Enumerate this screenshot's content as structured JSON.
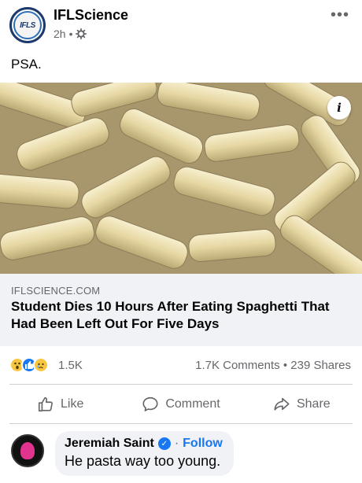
{
  "post": {
    "page_name": "IFLScience",
    "avatar_text": "IFLS",
    "time": "2h",
    "separator": "•",
    "more": "•••",
    "text": "PSA."
  },
  "image": {
    "info_label": "i"
  },
  "link": {
    "domain": "IFLSCIENCE.COM",
    "headline": "Student Dies 10 Hours After Eating Spaghetti That Had Been Left Out For Five Days"
  },
  "stats": {
    "reaction_count": "1.5K",
    "comments": "1.7K Comments",
    "dot": "•",
    "shares": "239 Shares"
  },
  "actions": {
    "like": "Like",
    "comment": "Comment",
    "share": "Share"
  },
  "comment": {
    "author": "Jeremiah Saint",
    "dot": "·",
    "follow": "Follow",
    "text": "He pasta way too young."
  },
  "colors": {
    "accent": "#1877f2",
    "secondary_text": "#65676b",
    "link_box": "#f0f2f5"
  }
}
